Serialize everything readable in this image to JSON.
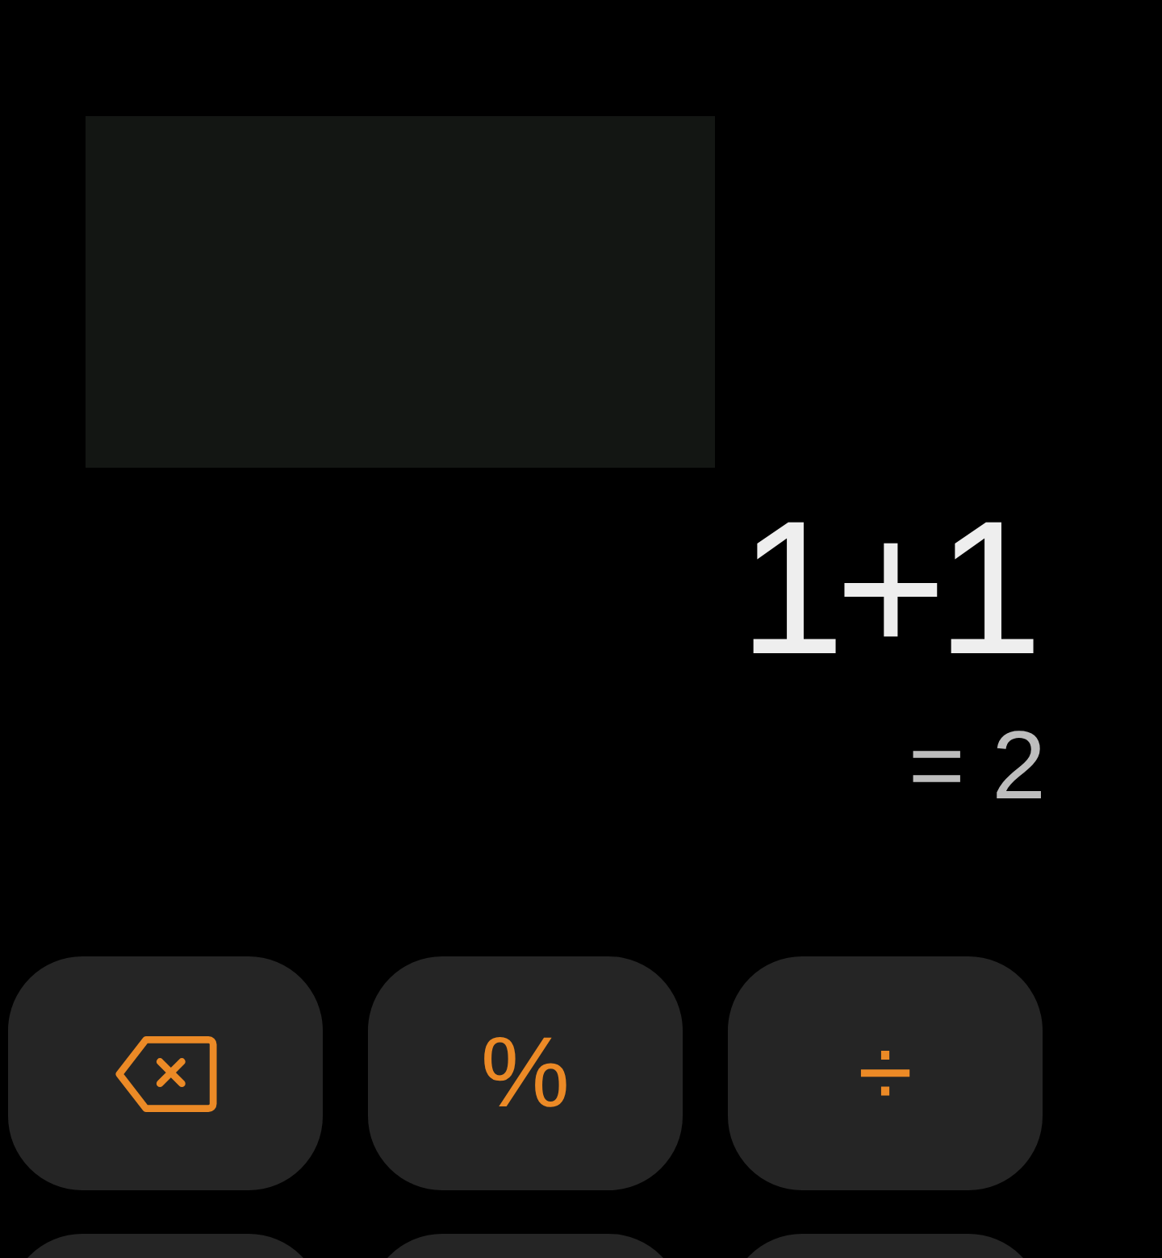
{
  "display": {
    "expression": "1+1",
    "result": "= 2"
  },
  "keypad": [
    [
      {
        "kind": "backspace"
      },
      {
        "kind": "text",
        "label": "%"
      },
      {
        "kind": "text",
        "label": "÷"
      }
    ],
    [
      {
        "kind": "cut"
      },
      {
        "kind": "cut"
      },
      {
        "kind": "cut"
      }
    ]
  ]
}
